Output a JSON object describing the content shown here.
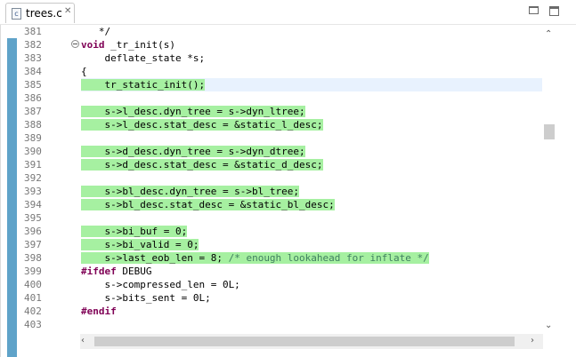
{
  "tab": {
    "label": "trees.c",
    "icon": "c-source-file-icon",
    "close_glyph": "✕"
  },
  "window_buttons": {
    "minimize": "minimize-icon",
    "maximize": "maximize-icon"
  },
  "colors": {
    "diff_highlight": "#a6f0a1",
    "keyword": "#7f0055",
    "comment": "#3f7f5f",
    "quick_diff": "#5fa3c9"
  },
  "lines": [
    {
      "n": "381",
      "segs": [
        {
          "t": "   */"
        }
      ]
    },
    {
      "n": "382",
      "segs": [
        {
          "t": "void",
          "c": "kw"
        },
        {
          "t": " _tr_init(s)"
        }
      ]
    },
    {
      "n": "383",
      "segs": [
        {
          "t": "    deflate_state *s;"
        }
      ]
    },
    {
      "n": "384",
      "segs": [
        {
          "t": "{"
        }
      ]
    },
    {
      "n": "385",
      "hl": "    tr_static_init();",
      "rest": []
    },
    {
      "n": "386",
      "segs": []
    },
    {
      "n": "387",
      "hl": "    s->l_desc.dyn_tree = s->dyn_ltree;",
      "rest": []
    },
    {
      "n": "388",
      "hl": "    s->l_desc.stat_desc = &static_l_desc;",
      "rest": []
    },
    {
      "n": "389",
      "segs": []
    },
    {
      "n": "390",
      "hl": "    s->d_desc.dyn_tree = s->dyn_dtree;",
      "rest": []
    },
    {
      "n": "391",
      "hl": "    s->d_desc.stat_desc = &static_d_desc;",
      "rest": []
    },
    {
      "n": "392",
      "segs": []
    },
    {
      "n": "393",
      "hl": "    s->bl_desc.dyn_tree = s->bl_tree;",
      "rest": []
    },
    {
      "n": "394",
      "hl": "    s->bl_desc.stat_desc = &static_bl_desc;",
      "rest": []
    },
    {
      "n": "395",
      "segs": []
    },
    {
      "n": "396",
      "hl": "    s->bi_buf = 0;",
      "rest": []
    },
    {
      "n": "397",
      "hl": "    s->bi_valid = 0;",
      "rest": []
    },
    {
      "n": "398",
      "hl": "    s->last_eob_len = 8; /* enough lookahead for inflate */",
      "rest": []
    },
    {
      "n": "399",
      "segs": [
        {
          "t": "#ifdef",
          "c": "pp"
        },
        {
          "t": " DEBUG"
        }
      ]
    },
    {
      "n": "400",
      "segs": [
        {
          "t": "    s->compressed_len = 0L;"
        }
      ]
    },
    {
      "n": "401",
      "segs": [
        {
          "t": "    s->bits_sent = 0L;"
        }
      ]
    },
    {
      "n": "402",
      "segs": [
        {
          "t": "#endif",
          "c": "pp"
        }
      ]
    },
    {
      "n": "403",
      "segs": []
    }
  ]
}
